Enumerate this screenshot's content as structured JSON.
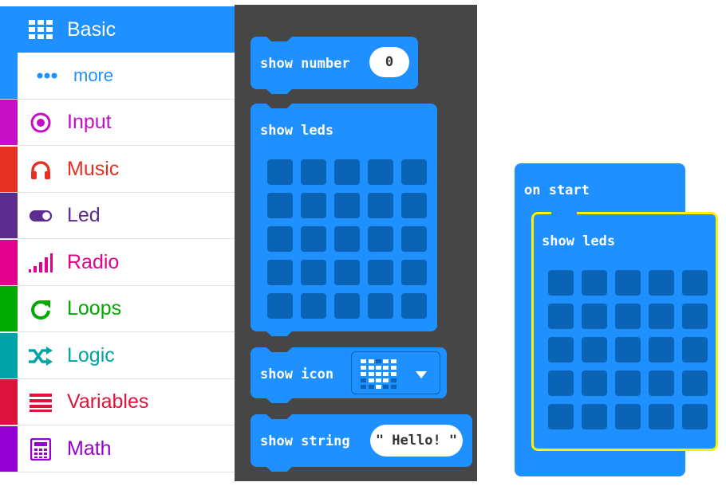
{
  "toolbox": {
    "categories": [
      {
        "id": "basic",
        "label": "Basic",
        "color": "#1e90ff",
        "icon": "grid-icon",
        "selected": true
      },
      {
        "id": "more",
        "label": "more",
        "color": "#1e90ff",
        "icon": "dots-icon"
      },
      {
        "id": "input",
        "label": "Input",
        "color": "#c40fc4",
        "icon": "target-icon"
      },
      {
        "id": "music",
        "label": "Music",
        "color": "#e63022",
        "icon": "headphones-icon"
      },
      {
        "id": "led",
        "label": "Led",
        "color": "#5c2d91",
        "icon": "toggle-icon"
      },
      {
        "id": "radio",
        "label": "Radio",
        "color": "#e3008c",
        "icon": "signal-bars-icon"
      },
      {
        "id": "loops",
        "label": "Loops",
        "color": "#00aa00",
        "icon": "refresh-icon"
      },
      {
        "id": "logic",
        "label": "Logic",
        "color": "#00a4a6",
        "icon": "shuffle-icon"
      },
      {
        "id": "variables",
        "label": "Variables",
        "color": "#dc143c",
        "icon": "lines-icon"
      },
      {
        "id": "math",
        "label": "Math",
        "color": "#9400d3",
        "icon": "calculator-icon"
      }
    ]
  },
  "flyout": {
    "show_number": {
      "label": "show number",
      "value": "0"
    },
    "show_leds": {
      "label": "show leds"
    },
    "show_icon": {
      "label": "show icon",
      "icon": "heart-icon"
    },
    "show_string": {
      "label": "show string",
      "value": "\" Hello! \""
    }
  },
  "workspace": {
    "on_start": {
      "label": "on start"
    },
    "show_leds": {
      "label": "show leds"
    }
  },
  "colors": {
    "block": "#1e90ff",
    "led_off": "#0b63b6",
    "flyout_bg": "#464646",
    "highlight": "#fff200"
  }
}
